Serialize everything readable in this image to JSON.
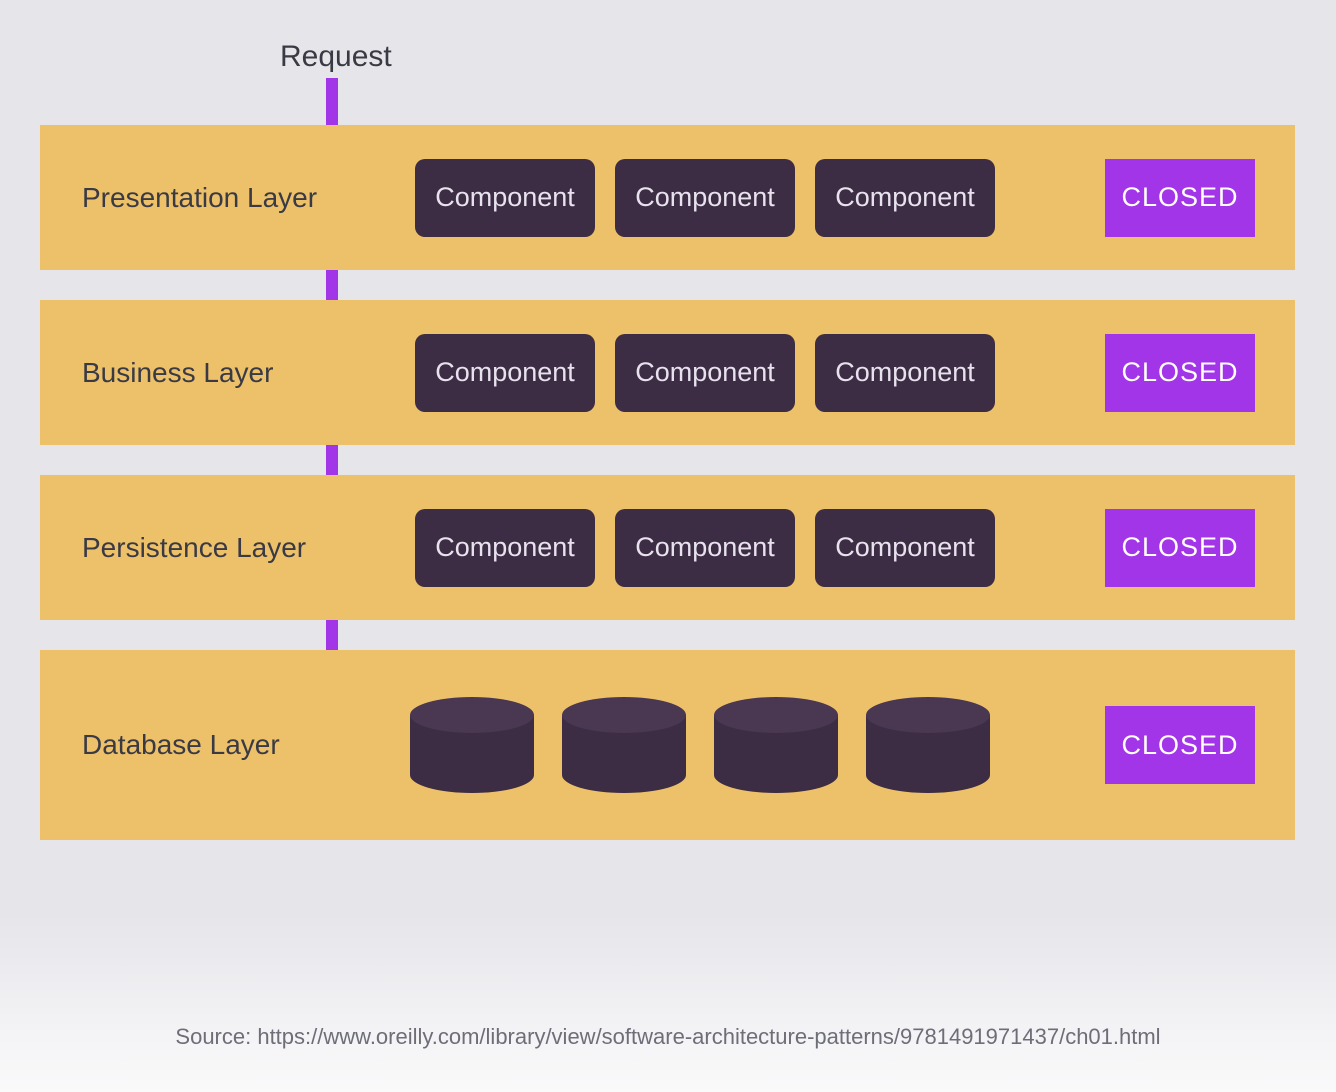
{
  "request_label": "Request",
  "layers": [
    {
      "title": "Presentation Layer",
      "components": [
        "Component",
        "Component",
        "Component"
      ],
      "status": "CLOSED",
      "kind": "component"
    },
    {
      "title": "Business Layer",
      "components": [
        "Component",
        "Component",
        "Component"
      ],
      "status": "CLOSED",
      "kind": "component"
    },
    {
      "title": "Persistence Layer",
      "components": [
        "Component",
        "Component",
        "Component"
      ],
      "status": "CLOSED",
      "kind": "component"
    },
    {
      "title": "Database Layer",
      "db_count": 4,
      "status": "CLOSED",
      "kind": "database"
    }
  ],
  "source_text": "Source: https://www.oreilly.com/library/view/software-architecture-patterns/9781491971437/ch01.html",
  "colors": {
    "background": "#e5e5ea",
    "layer_bg": "#edc06a",
    "component_bg": "#3c2c44",
    "component_fg": "#e8e2ef",
    "accent_purple": "#a335e8",
    "text_dark": "#3a3a44"
  }
}
